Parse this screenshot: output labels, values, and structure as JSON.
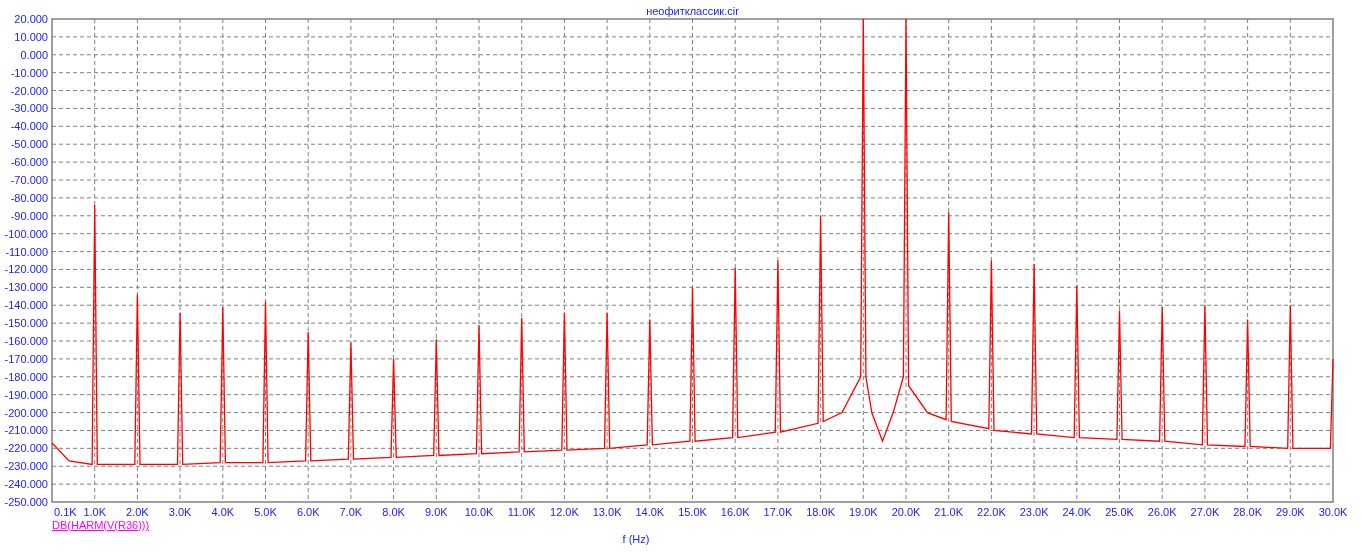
{
  "chart": {
    "chart_data": {
      "type": "line",
      "grid": true,
      "title": "неофитклассик.cir",
      "xlabel": "f (Hz)",
      "xlim": [
        0,
        30000
      ],
      "ylim": [
        -250,
        20
      ],
      "xticks": [
        {
          "value": 100,
          "label": "0.1K"
        },
        {
          "value": 1000,
          "label": "1.0K"
        },
        {
          "value": 2000,
          "label": "2.0K"
        },
        {
          "value": 3000,
          "label": "3.0K"
        },
        {
          "value": 4000,
          "label": "4.0K"
        },
        {
          "value": 5000,
          "label": "5.0K"
        },
        {
          "value": 6000,
          "label": "6.0K"
        },
        {
          "value": 7000,
          "label": "7.0K"
        },
        {
          "value": 8000,
          "label": "8.0K"
        },
        {
          "value": 9000,
          "label": "9.0K"
        },
        {
          "value": 10000,
          "label": "10.0K"
        },
        {
          "value": 11000,
          "label": "11.0K"
        },
        {
          "value": 12000,
          "label": "12.0K"
        },
        {
          "value": 13000,
          "label": "13.0K"
        },
        {
          "value": 14000,
          "label": "14.0K"
        },
        {
          "value": 15000,
          "label": "15.0K"
        },
        {
          "value": 16000,
          "label": "16.0K"
        },
        {
          "value": 17000,
          "label": "17.0K"
        },
        {
          "value": 18000,
          "label": "18.0K"
        },
        {
          "value": 19000,
          "label": "19.0K"
        },
        {
          "value": 20000,
          "label": "20.0K"
        },
        {
          "value": 21000,
          "label": "21.0K"
        },
        {
          "value": 22000,
          "label": "22.0K"
        },
        {
          "value": 23000,
          "label": "23.0K"
        },
        {
          "value": 24000,
          "label": "24.0K"
        },
        {
          "value": 25000,
          "label": "25.0K"
        },
        {
          "value": 26000,
          "label": "26.0K"
        },
        {
          "value": 27000,
          "label": "27.0K"
        },
        {
          "value": 28000,
          "label": "28.0K"
        },
        {
          "value": 29000,
          "label": "29.0K"
        },
        {
          "value": 30000,
          "label": "30.0K"
        }
      ],
      "yticks": [
        {
          "value": 20,
          "label": "20.000"
        },
        {
          "value": 10,
          "label": "10.000"
        },
        {
          "value": 0,
          "label": "0.000"
        },
        {
          "value": -10,
          "label": "-10.000"
        },
        {
          "value": -20,
          "label": "-20.000"
        },
        {
          "value": -30,
          "label": "-30.000"
        },
        {
          "value": -40,
          "label": "-40.000"
        },
        {
          "value": -50,
          "label": "-50.000"
        },
        {
          "value": -60,
          "label": "-60.000"
        },
        {
          "value": -70,
          "label": "-70.000"
        },
        {
          "value": -80,
          "label": "-80.000"
        },
        {
          "value": -90,
          "label": "-90.000"
        },
        {
          "value": -100,
          "label": "-100.000"
        },
        {
          "value": -110,
          "label": "-110.000"
        },
        {
          "value": -120,
          "label": "-120.000"
        },
        {
          "value": -130,
          "label": "-130.000"
        },
        {
          "value": -140,
          "label": "-140.000"
        },
        {
          "value": -150,
          "label": "-150.000"
        },
        {
          "value": -160,
          "label": "-160.000"
        },
        {
          "value": -170,
          "label": "-170.000"
        },
        {
          "value": -180,
          "label": "-180.000"
        },
        {
          "value": -190,
          "label": "-190.000"
        },
        {
          "value": -200,
          "label": "-200.000"
        },
        {
          "value": -210,
          "label": "-210.000"
        },
        {
          "value": -220,
          "label": "-220.000"
        },
        {
          "value": -230,
          "label": "-230.000"
        },
        {
          "value": -240,
          "label": "-240.000"
        },
        {
          "value": -250,
          "label": "-250.000"
        }
      ],
      "x": [
        0,
        400,
        940,
        1000,
        1060,
        1940,
        2000,
        2060,
        2940,
        3000,
        3060,
        3940,
        4000,
        4060,
        4940,
        5000,
        5060,
        5940,
        6000,
        6060,
        6940,
        7000,
        7060,
        7940,
        8000,
        8060,
        8940,
        9000,
        9060,
        9940,
        10000,
        10060,
        10940,
        11000,
        11060,
        11940,
        12000,
        12060,
        12940,
        13000,
        13060,
        13940,
        14000,
        14060,
        14940,
        15000,
        15060,
        15940,
        16000,
        16060,
        16940,
        17000,
        17060,
        17940,
        18000,
        18060,
        18500,
        18940,
        19000,
        19060,
        19200,
        19450,
        19700,
        19940,
        20000,
        20060,
        20500,
        20940,
        21000,
        21060,
        21940,
        22000,
        22060,
        22940,
        23000,
        23060,
        23940,
        24000,
        24060,
        24940,
        25000,
        25060,
        25940,
        26000,
        26060,
        26940,
        27000,
        27060,
        27940,
        28000,
        28060,
        28940,
        29000,
        29060,
        29940,
        30000
      ],
      "series": [
        {
          "name": "DB(HARM(V(R36)))",
          "color": "#ff0000",
          "values": [
            -217,
            -227,
            -229,
            -84,
            -229,
            -229,
            -134,
            -229,
            -229,
            -144,
            -229,
            -228,
            -141,
            -228,
            -228,
            -138,
            -228,
            -227,
            -155,
            -227,
            -226,
            -161,
            -226,
            -225,
            -170,
            -225,
            -224,
            -159,
            -224,
            -223,
            -151,
            -223,
            -222,
            -147,
            -222,
            -221,
            -144,
            -221,
            -220,
            -144,
            -220,
            -218,
            -148,
            -218,
            -216,
            -130,
            -216,
            -214,
            -119,
            -214,
            -211,
            -115,
            -211,
            -206,
            -90,
            -205,
            -200,
            -180,
            20,
            -180,
            -200,
            -216,
            -200,
            -180,
            20,
            -185,
            -200,
            -204,
            -88,
            -205,
            -209,
            -115,
            -210,
            -212,
            -117,
            -212,
            -214,
            -129,
            -214,
            -215,
            -143,
            -215,
            -216,
            -141,
            -216,
            -218,
            -140,
            -218,
            -219,
            -148,
            -219,
            -220,
            -140,
            -220,
            -220,
            -170
          ]
        }
      ]
    }
  }
}
